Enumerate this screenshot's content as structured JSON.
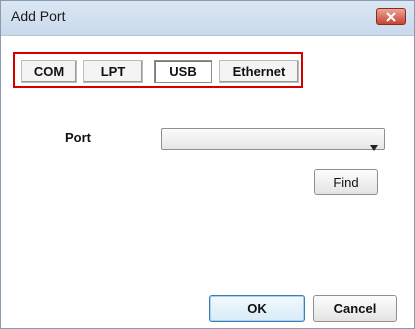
{
  "window": {
    "title": "Add Port",
    "close_icon": "close-icon"
  },
  "tabs": [
    {
      "label": "COM",
      "active": false
    },
    {
      "label": "LPT",
      "active": false
    },
    {
      "label": "USB",
      "active": true
    },
    {
      "label": "Ethernet",
      "active": false
    }
  ],
  "form": {
    "port_label": "Port",
    "port_value": "",
    "find_label": "Find"
  },
  "footer": {
    "ok_label": "OK",
    "cancel_label": "Cancel"
  },
  "colors": {
    "highlight": "#d40000",
    "titlebar": "#c9d9ec",
    "close": "#c7442f"
  }
}
